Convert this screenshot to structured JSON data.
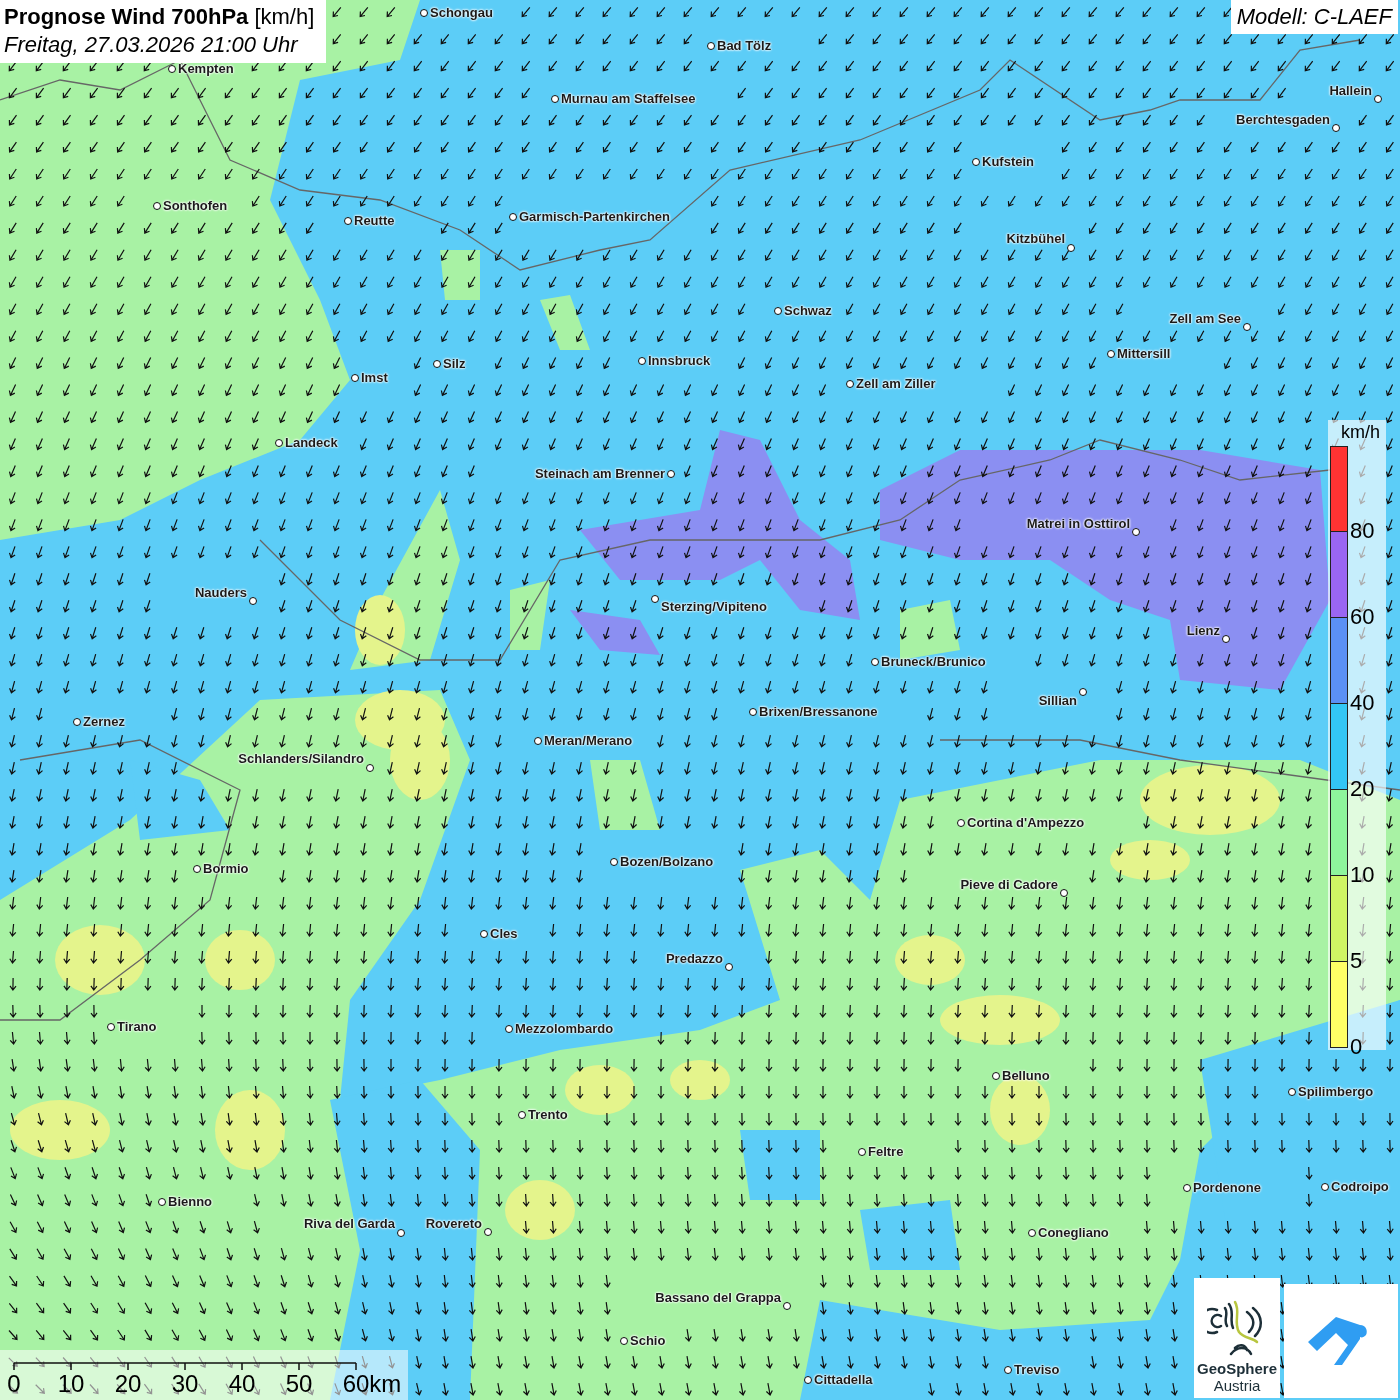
{
  "header": {
    "title": "**Prognose Wind 700hPa** [km/h]",
    "subtitle": "Freitag, 27.03.2026 21:00 Uhr"
  },
  "model": "Modell: C-LAEF",
  "cities": [
    {
      "name": "Schongau"
    },
    {
      "name": "Bad Tölz"
    },
    {
      "name": "Kempten"
    },
    {
      "name": "Murnau am Staffelsee"
    },
    {
      "name": "Hallein"
    },
    {
      "name": "Berchtesgaden"
    },
    {
      "name": "Kufstein"
    },
    {
      "name": "Sonthofen"
    },
    {
      "name": "Reutte"
    },
    {
      "name": "Garmisch-Partenkirchen"
    },
    {
      "name": "Kitzbühel"
    },
    {
      "name": "Schwaz"
    },
    {
      "name": "Zell am See"
    },
    {
      "name": "Mittersill"
    },
    {
      "name": "Silz"
    },
    {
      "name": "Innsbruck"
    },
    {
      "name": "Imst"
    },
    {
      "name": "Zell am Ziller"
    },
    {
      "name": "Landeck"
    },
    {
      "name": "Steinach am Brenner"
    },
    {
      "name": "Matrei in Osttirol"
    },
    {
      "name": "Nauders"
    },
    {
      "name": "Sterzing/Vipiteno"
    },
    {
      "name": "Lienz"
    },
    {
      "name": "Bruneck/Brunico"
    },
    {
      "name": "Sillian"
    },
    {
      "name": "Brixen/Bressanone"
    },
    {
      "name": "Zernez"
    },
    {
      "name": "Meran/Merano"
    },
    {
      "name": "Schlanders/Silandro"
    },
    {
      "name": "Cortina d'Ampezzo"
    },
    {
      "name": "Bozen/Bolzano"
    },
    {
      "name": "Bormio"
    },
    {
      "name": "Pieve di Cadore"
    },
    {
      "name": "Cles"
    },
    {
      "name": "Predazzo"
    },
    {
      "name": "Tirano"
    },
    {
      "name": "Mezzolombardo"
    },
    {
      "name": "Belluno"
    },
    {
      "name": "Spilimbergo"
    },
    {
      "name": "Trento"
    },
    {
      "name": "Feltre"
    },
    {
      "name": "Pordenone"
    },
    {
      "name": "Codroipo"
    },
    {
      "name": "Bienno"
    },
    {
      "name": "Riva del Garda"
    },
    {
      "name": "Rovereto"
    },
    {
      "name": "Conegliano"
    },
    {
      "name": "Bassano del Grappa"
    },
    {
      "name": "Schio"
    },
    {
      "name": "Treviso"
    },
    {
      "name": "Cittadella"
    }
  ],
  "legend": {
    "unit": "km/h",
    "bands": [
      {
        "label": "80",
        "color": "#ff3333"
      },
      {
        "label": "60",
        "color": "#9a66f2"
      },
      {
        "label": "40",
        "color": "#5b90f5"
      },
      {
        "label": "20",
        "color": "#33c6f5"
      },
      {
        "label": "10",
        "color": "#8ef59c"
      },
      {
        "label": "5",
        "color": "#cff564"
      },
      {
        "label": "0",
        "color": "#ffff66"
      }
    ]
  },
  "scale": {
    "ticks": [
      "0",
      "10",
      "20",
      "30",
      "40",
      "50",
      "60km"
    ]
  },
  "logo": {
    "name": "GeoSphere",
    "subtitle": "Austria"
  }
}
